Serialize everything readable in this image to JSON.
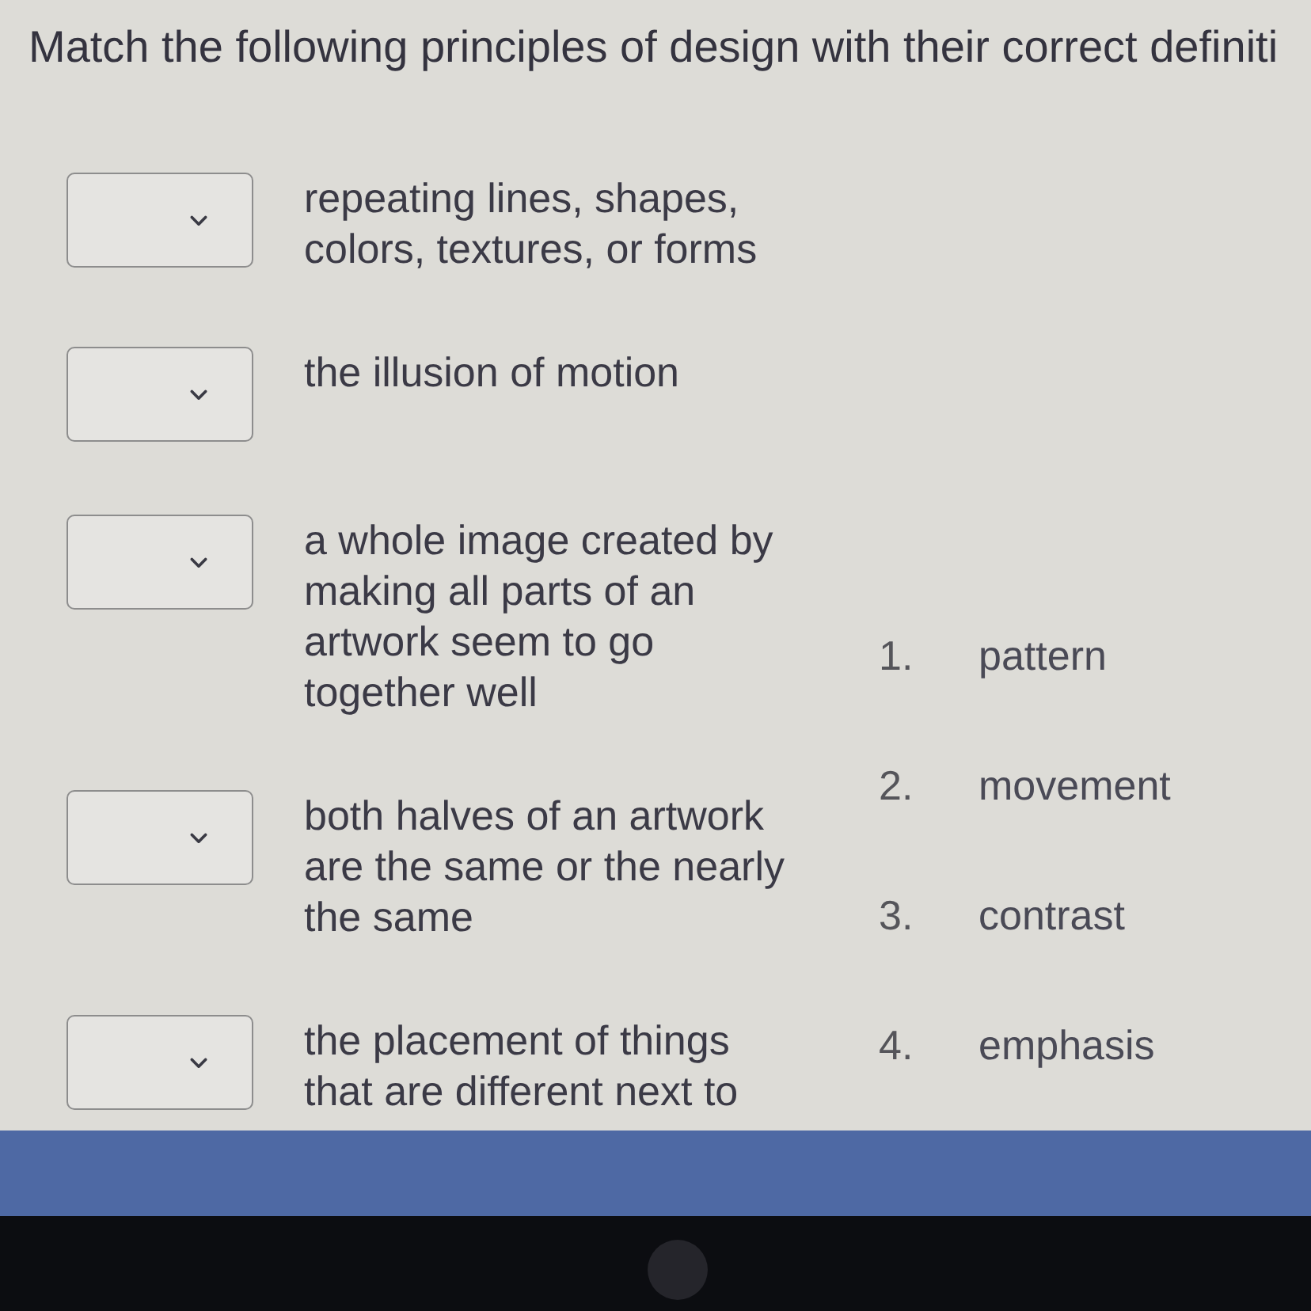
{
  "question": {
    "text": "Match the following principles of design with their correct definiti"
  },
  "matches": [
    {
      "definition": "repeating lines, shapes, colors, textures, or forms"
    },
    {
      "definition": "the illusion of motion"
    },
    {
      "definition": "a whole image created by making all parts of an artwork seem to go together well"
    },
    {
      "definition": "both halves of an artwork are the same or the nearly the same"
    },
    {
      "definition": "the placement of things that are different next to"
    }
  ],
  "options": [
    {
      "number": "1.",
      "label": "pattern"
    },
    {
      "number": "2.",
      "label": "movement"
    },
    {
      "number": "3.",
      "label": "contrast"
    },
    {
      "number": "4.",
      "label": "emphasis"
    }
  ]
}
